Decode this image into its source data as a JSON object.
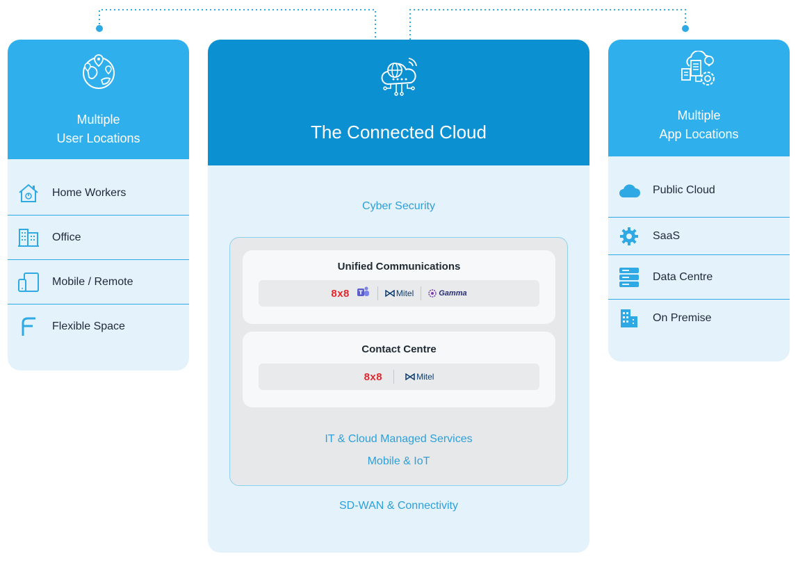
{
  "left_panel": {
    "title_line1": "Multiple",
    "title_line2": "User Locations",
    "items": [
      {
        "label": "Home Workers",
        "icon": "home-icon"
      },
      {
        "label": "Office",
        "icon": "office-building-icon"
      },
      {
        "label": "Mobile / Remote",
        "icon": "mobile-tablet-icon"
      },
      {
        "label": "Flexible Space",
        "icon": "flexible-space-icon"
      }
    ]
  },
  "center_panel": {
    "title": "The Connected Cloud",
    "icon": "cloud-network-icon",
    "cyber_security": "Cyber Security",
    "unified_comms": {
      "title": "Unified Communications",
      "logos": [
        "8x8",
        "Microsoft Teams",
        "Mitel",
        "Gamma"
      ],
      "logo_8x8": "8x8",
      "logo_mitel": "Mitel",
      "logo_gamma": "Gamma"
    },
    "contact_centre": {
      "title": "Contact Centre",
      "logo_8x8": "8x8",
      "logo_mitel": "Mitel"
    },
    "it_services": "IT & Cloud Managed Services",
    "mobile_iot": "Mobile & IoT",
    "sdwan": "SD-WAN & Connectivity"
  },
  "right_panel": {
    "title_line1": "Multiple",
    "title_line2": "App Locations",
    "items": [
      {
        "label": "Public Cloud",
        "icon": "cloud-icon"
      },
      {
        "label": "SaaS",
        "icon": "gear-icon"
      },
      {
        "label": "Data Centre",
        "icon": "server-stack-icon"
      },
      {
        "label": "On Premise",
        "icon": "buildings-icon"
      }
    ]
  },
  "colors": {
    "primary": "#0b90d1",
    "accent": "#2fb0ec",
    "panel_bg": "#e3f2fb",
    "text_link": "#2f9fd8"
  }
}
